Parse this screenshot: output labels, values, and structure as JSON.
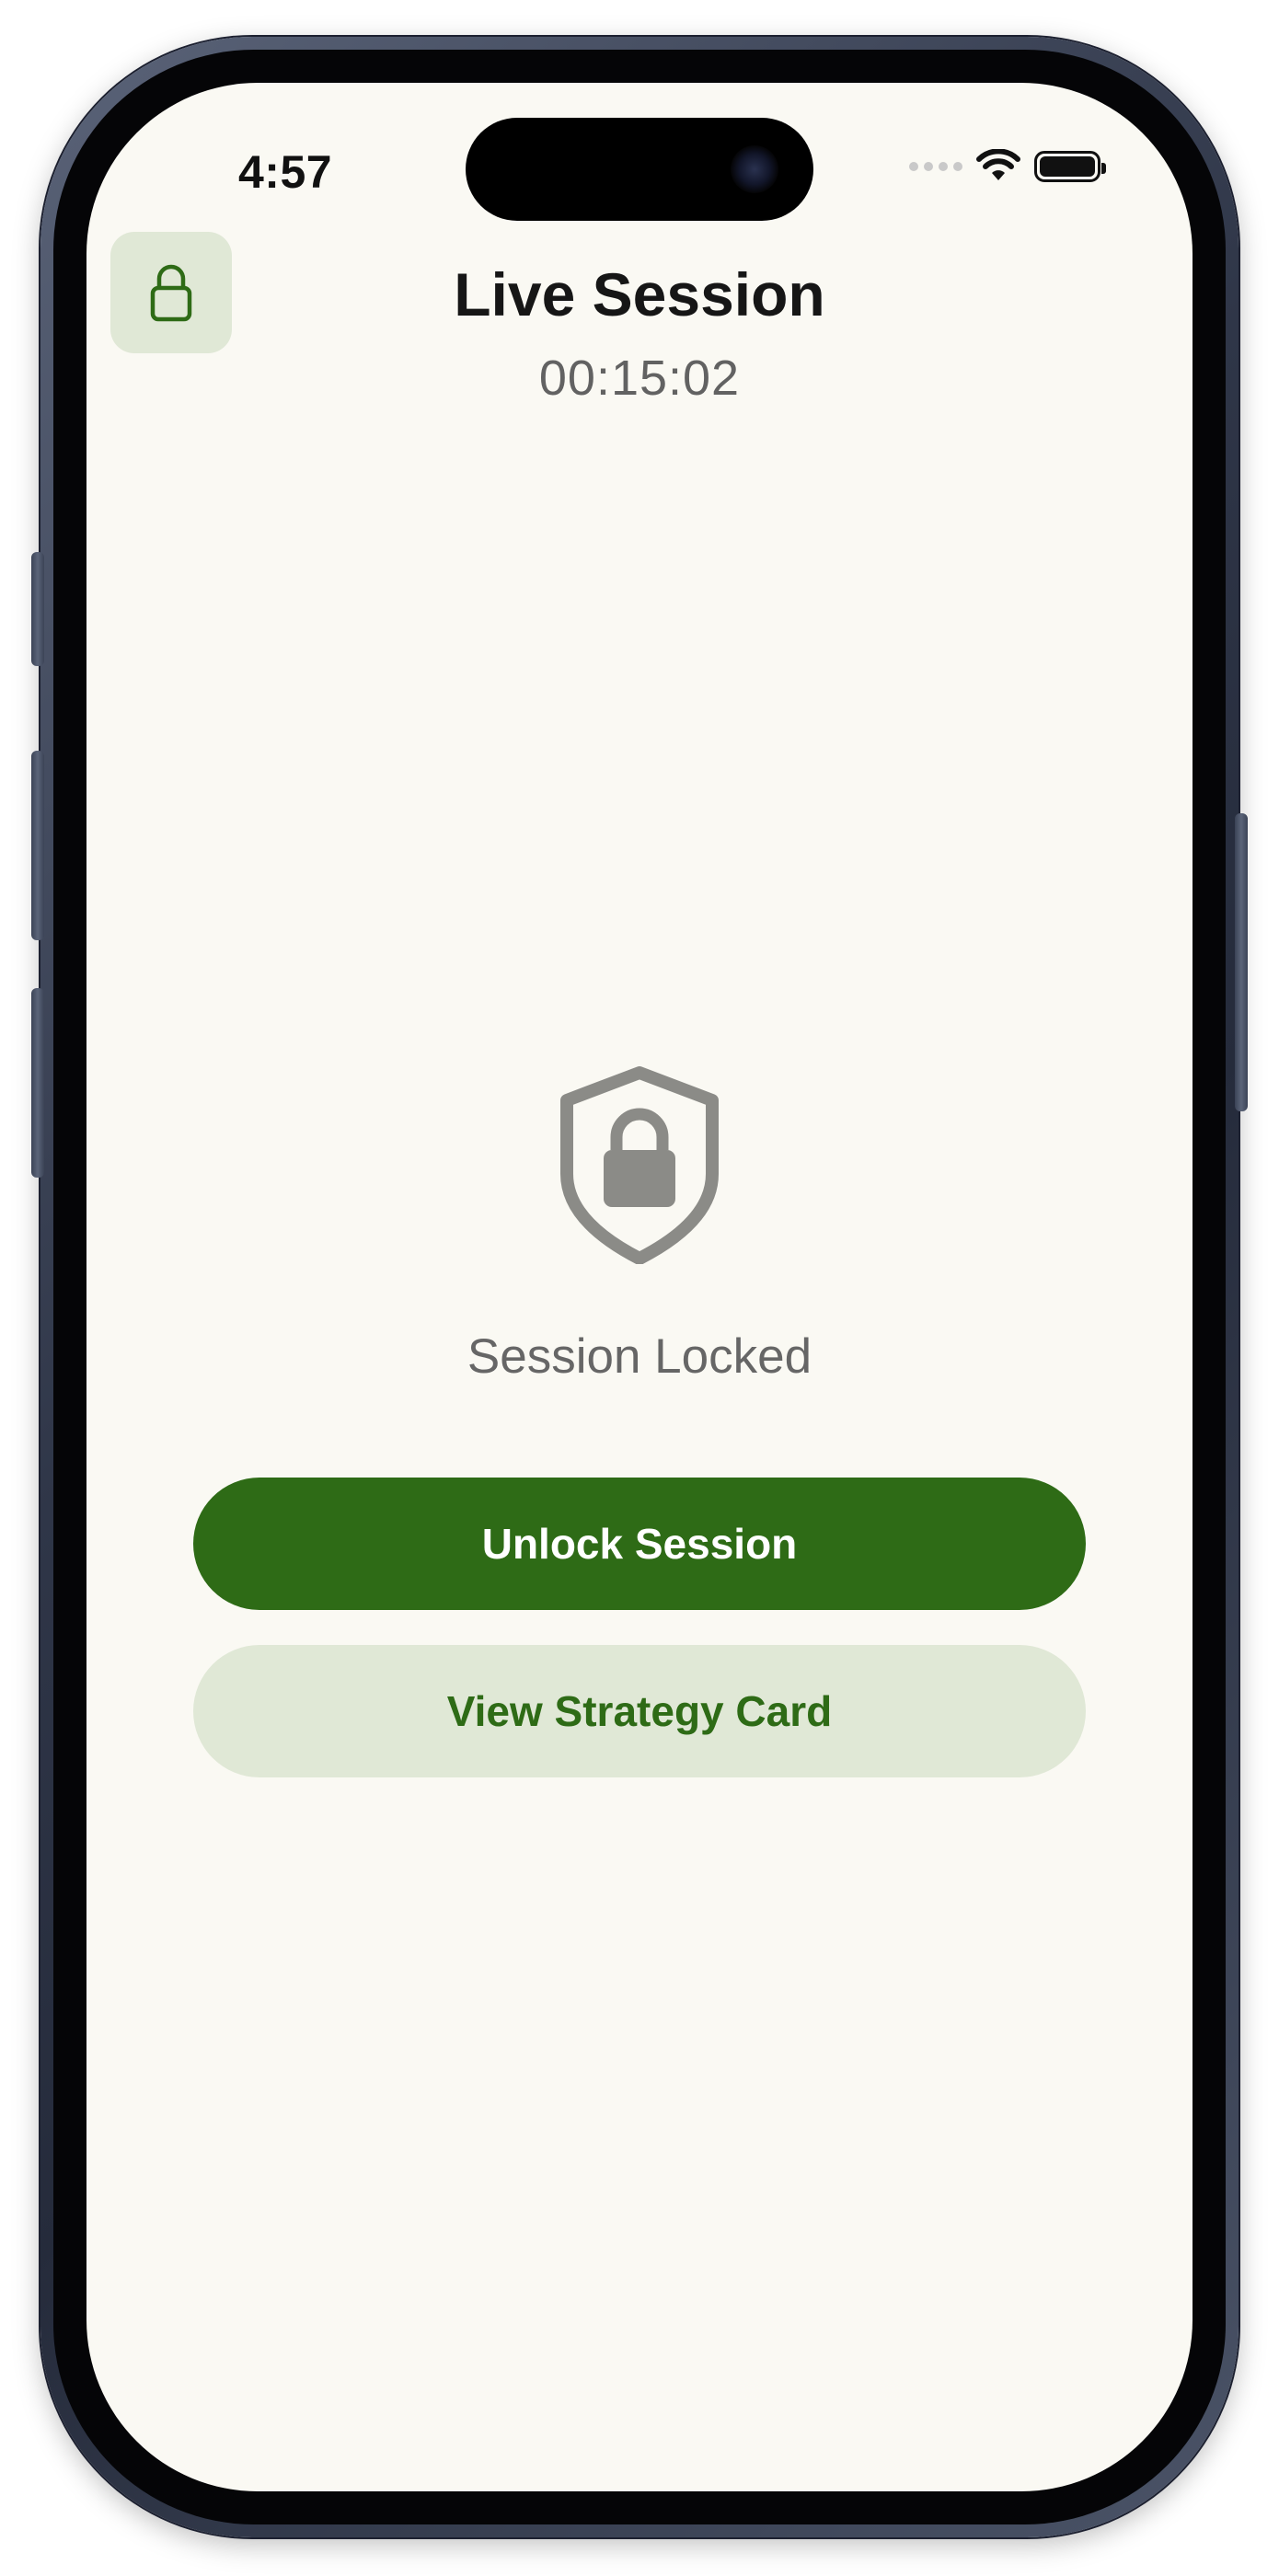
{
  "status_bar": {
    "time": "4:57"
  },
  "header": {
    "title": "Live Session",
    "timer": "00:15:02",
    "lock_icon": "lock-icon"
  },
  "lock_state": {
    "icon": "shield-lock-icon",
    "label": "Session Locked"
  },
  "actions": {
    "unlock_label": "Unlock Session",
    "strategy_label": "View Strategy Card"
  },
  "colors": {
    "accent": "#2e6b16",
    "accent_soft": "#e0e8d6",
    "background": "#faf9f3",
    "muted_icon": "#8b8b87"
  }
}
